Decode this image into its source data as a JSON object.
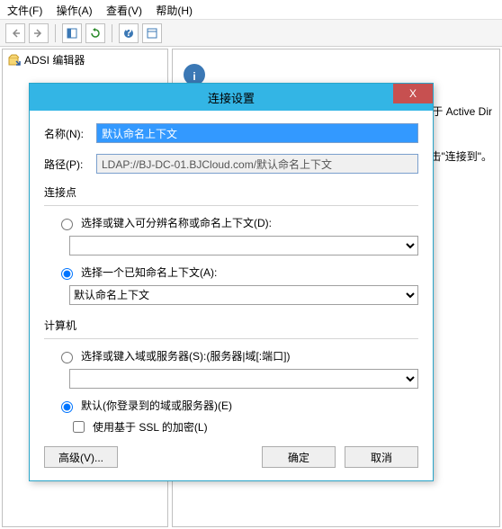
{
  "menubar": {
    "file": "文件(F)",
    "action": "操作(A)",
    "view": "查看(V)",
    "help": "帮助(H)"
  },
  "sidebar": {
    "title": "ADSI 编辑器"
  },
  "rightpane": {
    "hint_tail": "个用于 Active Dir",
    "hint2_tail": "上单击\"连接到\"。"
  },
  "dialog": {
    "title": "连接设置",
    "close": "X",
    "name_label": "名称(N):",
    "name_value": "默认命名上下文",
    "path_label": "路径(P):",
    "path_value": "LDAP://BJ-DC-01.BJCloud.com/默认命名上下文",
    "conn_group": "连接点",
    "radio_dn": "选择或键入可分辨名称或命名上下文(D):",
    "radio_known": "选择一个已知命名上下文(A):",
    "known_value": "默认命名上下文",
    "comp_group": "计算机",
    "radio_server": "选择或键入域或服务器(S):(服务器|域[:端口])",
    "radio_default": "默认(你登录到的域或服务器)(E)",
    "chk_ssl": "使用基于 SSL 的加密(L)",
    "btn_advanced": "高级(V)...",
    "btn_ok": "确定",
    "btn_cancel": "取消"
  }
}
